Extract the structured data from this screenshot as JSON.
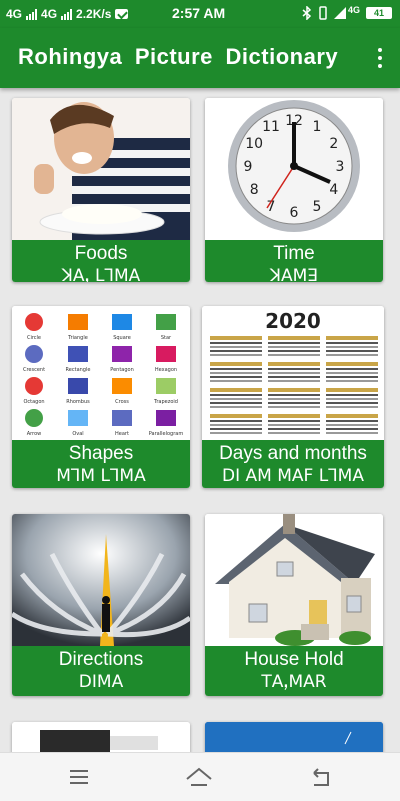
{
  "status_bar": {
    "net1": "4G",
    "net2": "4G",
    "speed": "2.2K/s",
    "time": "2:57  AM",
    "net3": "4G",
    "battery": "41"
  },
  "app_bar": {
    "title": "Rohingya  Picture  Dictionary"
  },
  "categories": [
    {
      "label": "Foods",
      "rohingya": "ꓘꓮꓹ ꓡꓶꓟꓮ"
    },
    {
      "label": "Time",
      "rohingya": "ꓘꓮꓟꓱ"
    },
    {
      "label": "Shapes",
      "rohingya": "ꓟꓶꓟ ꓡꓶꓟꓮ"
    },
    {
      "label": "Days  and  months",
      "rohingya": "ꓓꓲ ꓮꓟ ꓟꓮꓝ ꓡꓶꓟꓮ"
    },
    {
      "label": "Directions",
      "rohingya": "ꓓꓲꓟꓮ"
    },
    {
      "label": "House Hold",
      "rohingya": "ꓔꓮꓹꓟꓮꓣ"
    }
  ],
  "clock": {
    "numerals": [
      "12",
      "1",
      "2",
      "3",
      "4",
      "5",
      "6",
      "7",
      "8",
      "9",
      "10",
      "11"
    ]
  },
  "calendar": {
    "year": "2020"
  },
  "shapes": {
    "names": [
      "Circle",
      "Triangle",
      "Square",
      "Star",
      "Crescent",
      "Rectangle",
      "Pentagon",
      "Hexagon",
      "Octagon",
      "Rhombus",
      "Cross",
      "Trapezoid",
      "Arrow",
      "Oval",
      "Heart",
      "Parallelogram"
    ]
  },
  "colors": {
    "primary": "#1e8a2c",
    "accent": "#1e8a2c"
  },
  "nav": {
    "icons": [
      "menu-icon",
      "home-icon",
      "back-icon"
    ]
  }
}
